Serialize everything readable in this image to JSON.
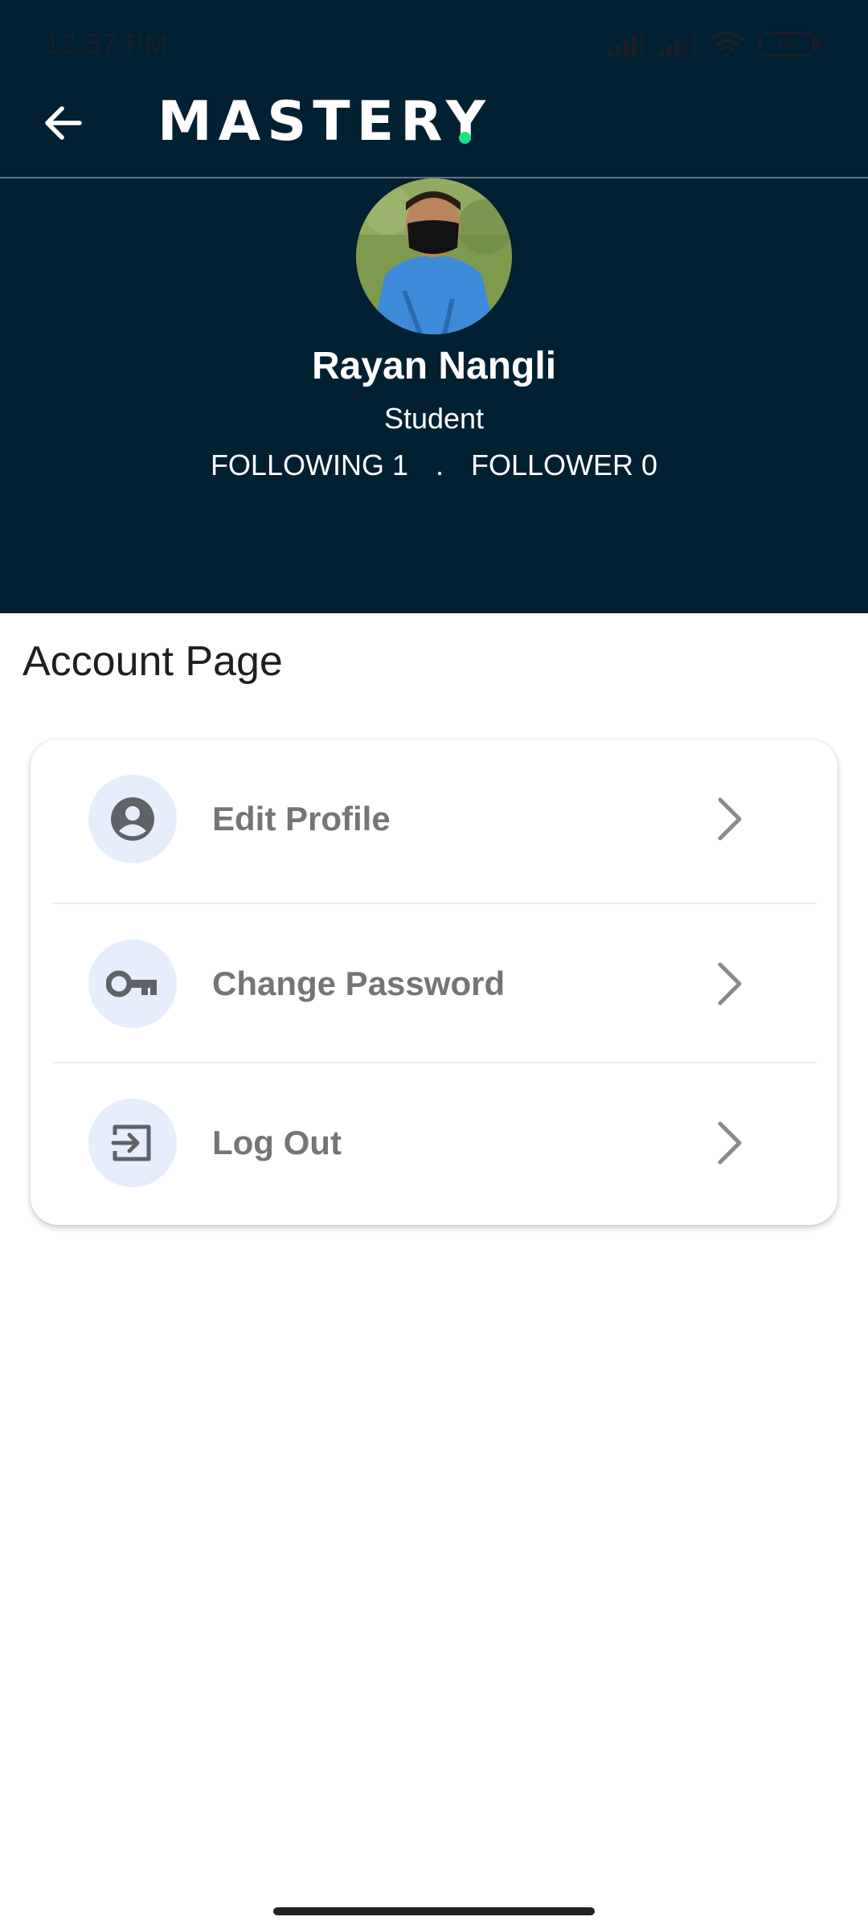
{
  "status_bar": {
    "time": "12:57 PM",
    "battery": "85",
    "icons": [
      "signal-icon",
      "signal-icon",
      "wifi-icon",
      "battery-icon"
    ]
  },
  "app_bar": {
    "back_icon": "arrow-left-icon",
    "logo_text": "MASTERY",
    "logo_dot_color": "#1ee07f"
  },
  "profile": {
    "name": "Rayan Nangli",
    "role": "Student",
    "following_label": "FOLLOWING 1",
    "separator": ".",
    "follower_label": "FOLLOWER 0"
  },
  "page": {
    "title": "Account Page"
  },
  "menu": {
    "items": [
      {
        "label": "Edit Profile",
        "icon": "account-circle-icon"
      },
      {
        "label": "Change Password",
        "icon": "key-icon"
      },
      {
        "label": "Log Out",
        "icon": "logout-icon"
      }
    ],
    "chevron_icon": "chevron-right-icon"
  },
  "colors": {
    "header_bg": "#012032",
    "icon_circle_bg": "#e6edfb",
    "menu_text": "#757575",
    "accent": "#1ee07f"
  }
}
